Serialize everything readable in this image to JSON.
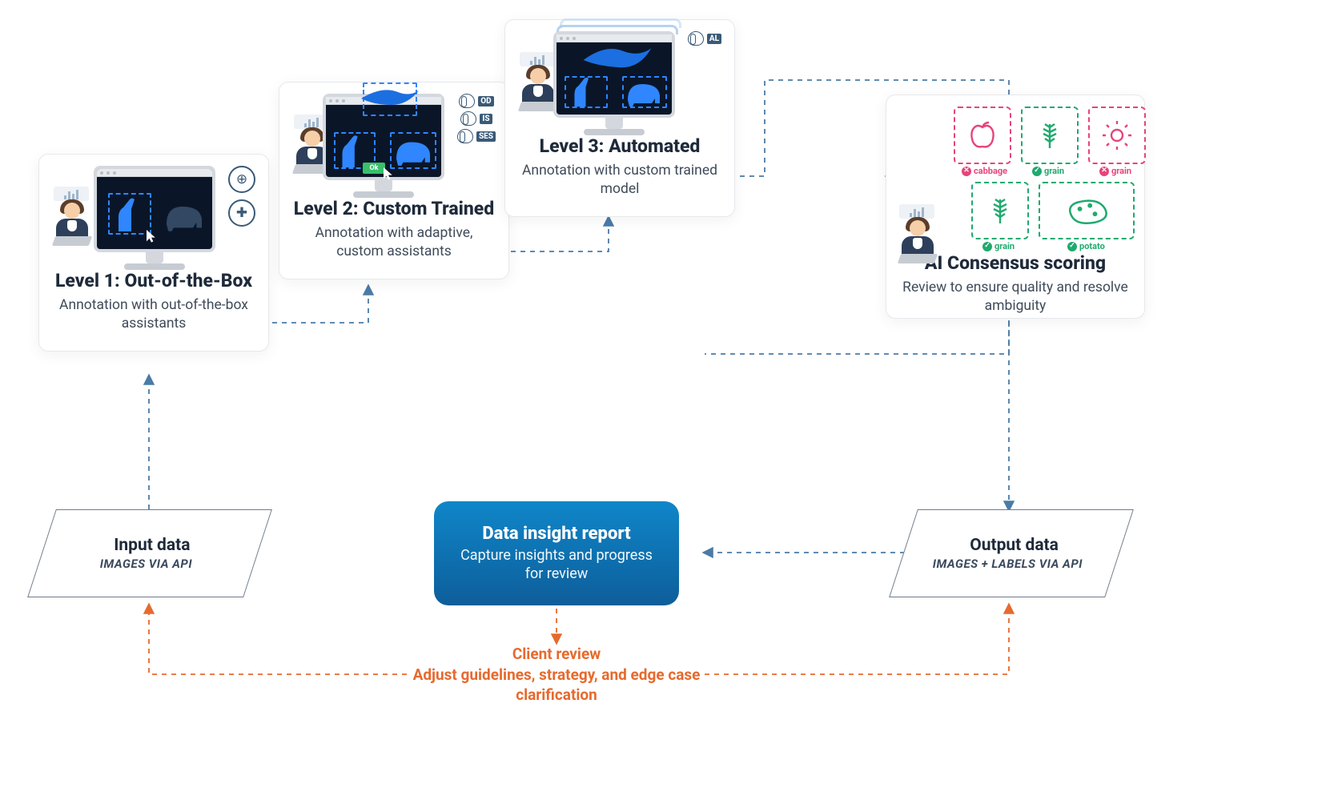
{
  "level1": {
    "title": "Level 1: Out-of-the-Box",
    "desc": "Annotation with out-of-the-box assistants"
  },
  "level2": {
    "title": "Level 2: Custom Trained",
    "desc": "Annotation with adaptive, custom assistants",
    "chips": {
      "c0": "OD",
      "c1": "IS",
      "c2": "SES"
    }
  },
  "level3": {
    "title": "Level 3: Automated",
    "desc": "Annotation with custom trained model",
    "chips": {
      "c0": "AL"
    }
  },
  "consensus": {
    "title": "AI Consensus scoring",
    "desc": "Review to ensure quality and resolve ambiguity",
    "tiles": {
      "cabbage": {
        "label": "cabbage",
        "status": "no"
      },
      "grain_top": {
        "label": "grain",
        "status": "yes"
      },
      "cog": {
        "label": "grain",
        "status": "no"
      },
      "grain_bot": {
        "label": "grain",
        "status": "yes"
      },
      "potato": {
        "label": "potato",
        "status": "yes"
      }
    }
  },
  "input": {
    "title": "Input data",
    "sub": "IMAGES VIA API"
  },
  "output": {
    "title": "Output data",
    "sub": "IMAGES + LABELS VIA API"
  },
  "report": {
    "title": "Data insight report",
    "sub": "Capture insights and progress for review"
  },
  "client": {
    "line1": "Client review",
    "line2": "Adjust guidelines, strategy, and edge case clarification"
  }
}
